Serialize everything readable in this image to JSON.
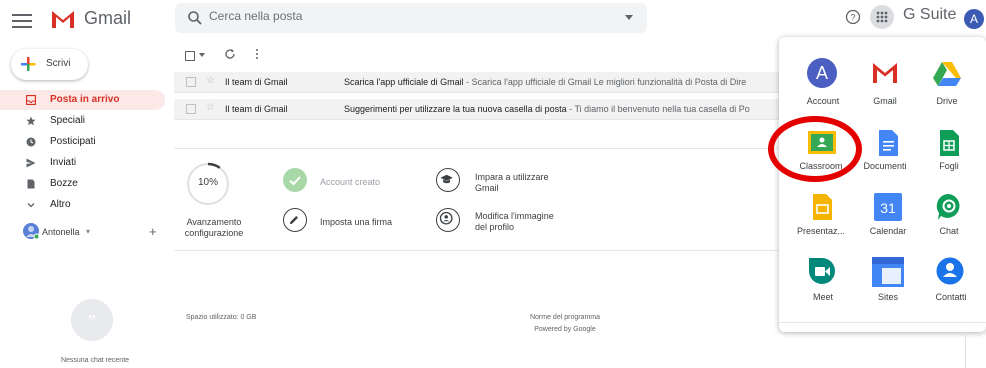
{
  "header": {
    "app_name": "Gmail",
    "search_placeholder": "Cerca nella posta",
    "gsuite_label": "G Suite",
    "avatar_letter": "A"
  },
  "compose": {
    "label": "Scrivi"
  },
  "sidebar": {
    "items": [
      {
        "label": "Posta in arrivo",
        "icon": "inbox-icon",
        "active": true
      },
      {
        "label": "Speciali",
        "icon": "star-icon"
      },
      {
        "label": "Posticipati",
        "icon": "clock-icon"
      },
      {
        "label": "Inviati",
        "icon": "send-icon"
      },
      {
        "label": "Bozze",
        "icon": "draft-icon"
      },
      {
        "label": "Altro",
        "icon": "chevron-down-icon"
      }
    ],
    "user": {
      "name": "Antonella",
      "caret": "▾",
      "add": "+"
    },
    "chat_empty": "Nessuna chat recente"
  },
  "emails": [
    {
      "sender": "Il team di Gmail",
      "subject": "Scarica l'app ufficiale di Gmail",
      "snippet": " - Scarica l'app ufficiale di Gmail Le migliori funzionalità di Posta di Dire"
    },
    {
      "sender": "Il team di Gmail",
      "subject": "Suggerimenti per utilizzare la tua nuova casella di posta",
      "snippet": " - Ti diamo il benvenuto nella tua casella di Po"
    }
  ],
  "setup": {
    "progress_value": 0.1,
    "progress_label": "10%",
    "caption_line1": "Avanzamento",
    "caption_line2": "configurazione",
    "tasks": [
      {
        "label": "Account creato",
        "done": true
      },
      {
        "label": "Imposta una firma",
        "done": false
      },
      {
        "label_line1": "Impara a utilizzare",
        "label_line2": "Gmail",
        "done": false
      },
      {
        "label_line1": "Modifica l'immagine",
        "label_line2": "del profilo",
        "done": false
      }
    ]
  },
  "footer": {
    "storage": "Spazio utilizzato: 0 GB",
    "policy": "Norme del programma",
    "powered": "Powered by Google"
  },
  "apps_panel": {
    "apps": [
      {
        "label": "Account",
        "icon": "account-icon"
      },
      {
        "label": "Gmail",
        "icon": "gmail-icon"
      },
      {
        "label": "Drive",
        "icon": "drive-icon"
      },
      {
        "label": "Classroom",
        "icon": "classroom-icon"
      },
      {
        "label": "Documenti",
        "icon": "docs-icon"
      },
      {
        "label": "Fogli",
        "icon": "sheets-icon"
      },
      {
        "label": "Presentaz...",
        "icon": "slides-icon"
      },
      {
        "label": "Calendar",
        "icon": "calendar-icon"
      },
      {
        "label": "Chat",
        "icon": "chat-icon"
      },
      {
        "label": "Meet",
        "icon": "meet-icon"
      },
      {
        "label": "Sites",
        "icon": "sites-icon"
      },
      {
        "label": "Contatti",
        "icon": "contacts-icon"
      }
    ],
    "account_letter": "A",
    "calendar_day": "31"
  },
  "colors": {
    "accent_red": "#d93025",
    "highlight": "#e50000",
    "avatar": "#3c5bb5"
  }
}
